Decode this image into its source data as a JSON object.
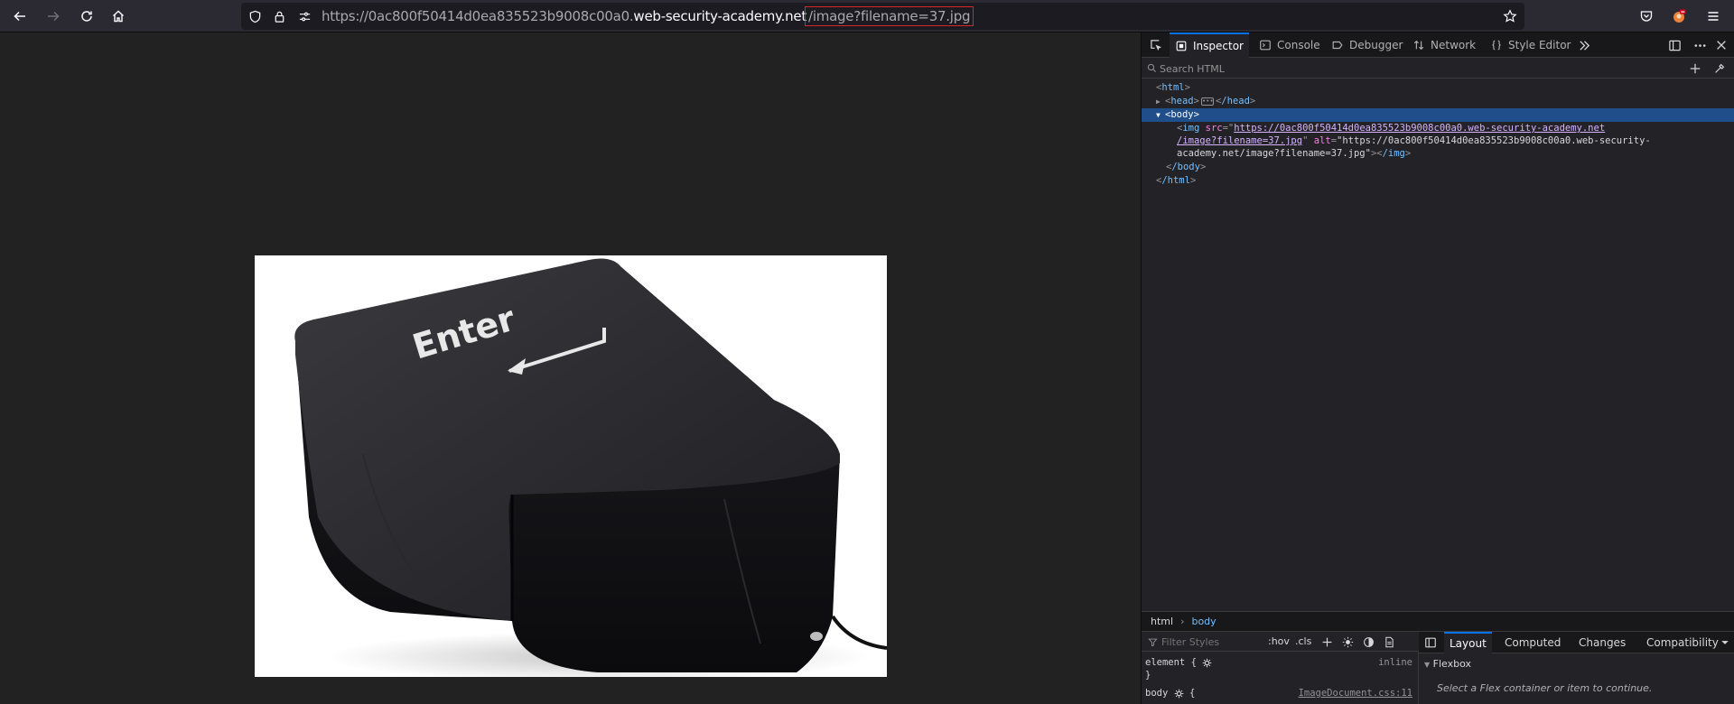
{
  "browser": {
    "url_prefix": "https://0ac800f50414d0ea835523b9008c00a0.",
    "url_host": "web-security-academy.net",
    "url_path": "/image?filename=37.jpg"
  },
  "devtools": {
    "tabs": [
      {
        "label": "Inspector",
        "icon": "inspector-icon"
      },
      {
        "label": "Console",
        "icon": "console-icon"
      },
      {
        "label": "Debugger",
        "icon": "debugger-icon"
      },
      {
        "label": "Network",
        "icon": "network-icon"
      },
      {
        "label": "Style Editor",
        "icon": "style-editor-icon"
      }
    ],
    "search_placeholder": "Search HTML",
    "markup": {
      "html_open": "html",
      "head": "head",
      "head_close": "/head",
      "body": "body",
      "img_tag": "img",
      "src_attr": "src",
      "src_value_line1": "https://0ac800f50414d0ea835523b9008c00a0.web-security-academy.net",
      "src_value_line2": "/image?filename=37.jpg",
      "alt_attr": "alt",
      "alt_value_line1": "\"https://0ac800f50414d0ea835523b9008c00a0.web-security-",
      "alt_value_line2": "academy.net/image?filename=37.jpg\"",
      "img_close": "/img",
      "body_close": "/body",
      "html_close": "/html"
    },
    "breadcrumbs": [
      "html",
      "body"
    ],
    "rules": {
      "filter_placeholder": "Filter Styles",
      "hov": ":hov",
      "cls": ".cls",
      "element_rule": "element {",
      "element_close": "}",
      "inline": "inline",
      "body_rule": "body",
      "body_brace": "{",
      "source": "ImageDocument.css:11"
    },
    "layout": {
      "tabs": [
        "Layout",
        "Computed",
        "Changes",
        "Compatibility"
      ],
      "flexbox_title": "Flexbox",
      "flexbox_hint": "Select a Flex container or item to continue."
    }
  },
  "image": {
    "key_label": "Enter"
  }
}
